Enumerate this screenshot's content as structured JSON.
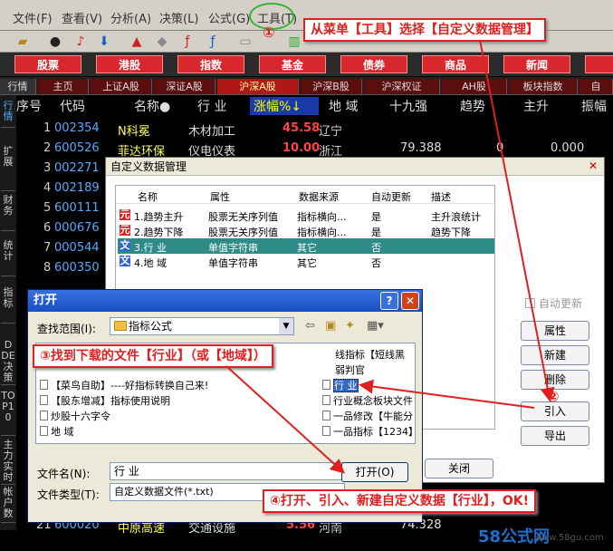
{
  "menu": [
    "文件(F)",
    "查看(V)",
    "分析(A)",
    "决策(L)",
    "公式(G)",
    "工具(T)"
  ],
  "toolbar_icons": [
    "folder-icon",
    "binoculars-icon",
    "alarm-icon",
    "down-arrow-icon",
    "chart-icon",
    "diamond-icon",
    "f-icon",
    "f-icon",
    "notepad-icon",
    "bar-chart-icon"
  ],
  "categories": [
    "股票",
    "港股",
    "指数",
    "基金",
    "债券",
    "商品",
    "新闻"
  ],
  "tabs": [
    "行情",
    "主页",
    "上证A股",
    "深证A股",
    "沪深A股",
    "沪深B股",
    "沪深权证",
    "AH股",
    "板块指数",
    "自"
  ],
  "side_tabs": [
    "行情",
    "扩展",
    "财务",
    "统计",
    "指标",
    "DDE决策",
    "TOP10",
    "主力实时",
    "帐户数"
  ],
  "grid": {
    "headers": [
      "序号",
      "代码",
      "名称●",
      "行 业",
      "涨幅%↓",
      "地 域",
      "十九强",
      "趋势",
      "主升",
      "振幅"
    ],
    "rows": [
      {
        "idx": "1",
        "code": "002354",
        "name": "N科冕",
        "ind": "木材加工",
        "pct": "45.58",
        "reg": "辽宁",
        "v1": "",
        "v2": "",
        "v3": ""
      },
      {
        "idx": "2",
        "code": "600526",
        "name": "菲达环保",
        "ind": "仪电仪表",
        "pct": "10.00",
        "reg": "浙江",
        "v1": "79.388",
        "v2": "0",
        "v3": "0.000"
      },
      {
        "idx": "3",
        "code": "002271",
        "name": "",
        "ind": "",
        "pct": "",
        "reg": "",
        "v1": "",
        "v2": "",
        "v3": ""
      },
      {
        "idx": "4",
        "code": "002189",
        "name": "",
        "ind": "",
        "pct": "",
        "reg": "",
        "v1": "",
        "v2": "",
        "v3": ""
      },
      {
        "idx": "5",
        "code": "600111",
        "name": "",
        "ind": "",
        "pct": "",
        "reg": "",
        "v1": "",
        "v2": "",
        "v3": ""
      },
      {
        "idx": "6",
        "code": "000676",
        "name": "",
        "ind": "",
        "pct": "",
        "reg": "",
        "v1": "",
        "v2": "",
        "v3": ""
      },
      {
        "idx": "7",
        "code": "000544",
        "name": "",
        "ind": "",
        "pct": "",
        "reg": "",
        "v1": "",
        "v2": "",
        "v3": ""
      },
      {
        "idx": "8",
        "code": "600350",
        "name": "",
        "ind": "",
        "pct": "",
        "reg": "",
        "v1": "",
        "v2": "",
        "v3": ""
      }
    ],
    "bottom_row": {
      "idx": "21",
      "code": "600020",
      "name": "中原高速",
      "ind": "交通设施",
      "pct": "5.56",
      "reg": "河南",
      "v1": "74.328"
    }
  },
  "custom_dialog": {
    "title": "自定义数据管理",
    "headers": [
      "名称",
      "属性",
      "数据来源",
      "自动更新",
      "描述"
    ],
    "rows": [
      {
        "icon": "元",
        "name": "1.趋势主升",
        "attr": "股票无关序列值",
        "src": "指标横向...",
        "auto": "是",
        "desc": "主升浪统计"
      },
      {
        "icon": "元",
        "name": "2.趋势下降",
        "attr": "股票无关序列值",
        "src": "指标横向...",
        "auto": "是",
        "desc": "趋势下降"
      },
      {
        "icon": "文",
        "name": "3.行  业",
        "attr": "单值字符串",
        "src": "其它",
        "auto": "否",
        "desc": ""
      },
      {
        "icon": "文",
        "name": "4.地  域",
        "attr": "单值字符串",
        "src": "其它",
        "auto": "否",
        "desc": ""
      }
    ],
    "auto_update_label": "自动更新",
    "buttons": [
      "属性",
      "新建",
      "删除",
      "引入",
      "导出"
    ],
    "close_label": "关闭"
  },
  "open_dialog": {
    "title": "打开",
    "lookin_label": "查找范围(I):",
    "lookin_value": "指标公式",
    "files_left": [
      "【菜鸟自助】----好指标转换自己来!",
      "【股东增减】指标使用说明",
      "炒股十六字令",
      "地  域"
    ],
    "files_right": [
      "线指标【短线黑",
      "弱判官",
      "行  业",
      "行业概念板块文件",
      "一品修改【牛能分",
      "一品指标【1234】"
    ],
    "filename_label": "文件名(N):",
    "filename_value": "行  业",
    "filetype_label": "文件类型(T):",
    "filetype_value": "自定义数据文件(*.txt)",
    "open_button": "打开(O)"
  },
  "callouts": {
    "c1": "从菜单【工具】选择【自定义数据管理】",
    "c3": "③找到下载的文件【行业】（或【地域】）",
    "c4": "④打开、引入、新建自定义数据【行业】，OK!",
    "n1": "①",
    "n2": "②"
  },
  "watermark": {
    "brand": "58公式网",
    "url": "www.58gu.com"
  },
  "colors": {
    "callout": "#e02020",
    "category": "#d8282e",
    "selected_row": "#2e8b88"
  }
}
